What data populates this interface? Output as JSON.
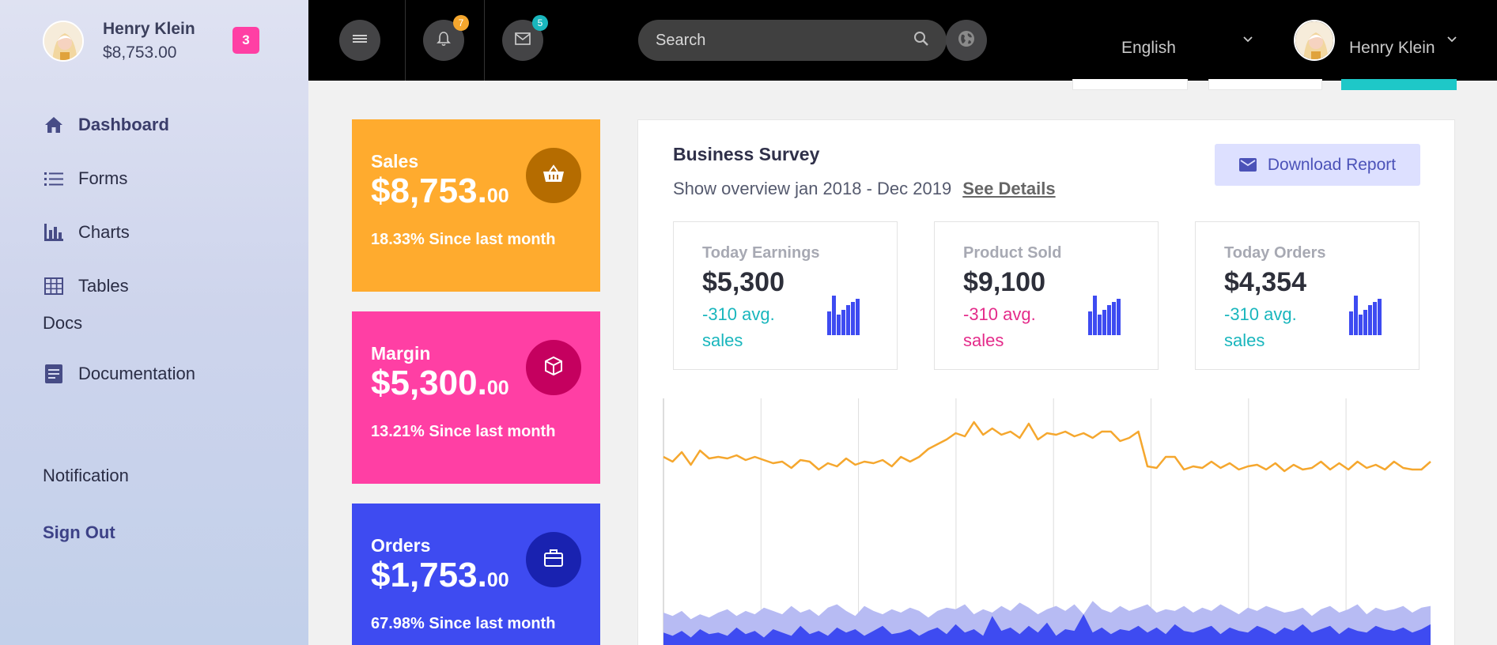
{
  "sidebar": {
    "user_name": "Henry Klein",
    "user_balance": "$8,753.00",
    "notification_badge": "3",
    "nav": [
      {
        "label": "Dashboard",
        "icon": "home-icon"
      },
      {
        "label": "Forms",
        "icon": "list-icon"
      },
      {
        "label": "Charts",
        "icon": "bar-chart-icon"
      },
      {
        "label": "Tables",
        "icon": "table-icon"
      }
    ],
    "docs_heading": "Docs",
    "documentation_label": "Documentation",
    "notification_label": "Notification",
    "signout_label": "Sign Out"
  },
  "topbar": {
    "bell_count": "7",
    "mail_count": "5",
    "search_placeholder": "Search",
    "language": "English",
    "user_name": "Henry Klein"
  },
  "cards": [
    {
      "title": "Sales",
      "value": "$8,753.",
      "cents": "00",
      "sub": "18.33% Since last month",
      "color": "#ffab2e",
      "icon_bg": "#b56c00",
      "icon": "basket-icon"
    },
    {
      "title": "Margin",
      "value": "$5,300.",
      "cents": "00",
      "sub": "13.21% Since last month",
      "color": "#ff3fa4",
      "icon_bg": "#c5005f",
      "icon": "cube-icon"
    },
    {
      "title": "Orders",
      "value": "$1,753.",
      "cents": "00",
      "sub": "67.98% Since last month",
      "color": "#3e4bf1",
      "icon_bg": "#1922b0",
      "icon": "briefcase-icon"
    }
  ],
  "survey": {
    "title": "Business Survey",
    "subtitle": "Show overview jan 2018 - Dec 2019",
    "see_details": "See Details",
    "download": "Download Report",
    "minis": [
      {
        "title": "Today Earnings",
        "value": "$5,300",
        "delta": "-310 avg. sales",
        "delta_color": "#19b6bd"
      },
      {
        "title": "Product Sold",
        "value": "$9,100",
        "delta": "-310 avg. sales",
        "delta_color": "#e42b8a"
      },
      {
        "title": "Today Orders",
        "value": "$4,354",
        "delta": "-310 avg. sales",
        "delta_color": "#19b6bd"
      }
    ]
  },
  "chart_data": {
    "type": "line",
    "title": "",
    "xlabel": "",
    "ylabel": "",
    "grid": "vertical",
    "series": [
      {
        "values": [
          58,
          55,
          61,
          53,
          62,
          57,
          58,
          57,
          59,
          56,
          58,
          56,
          54,
          55,
          51,
          56,
          55,
          50,
          54,
          52,
          57,
          53,
          55,
          54,
          56,
          52,
          58,
          55,
          58,
          63,
          66,
          69,
          73,
          71,
          80,
          72,
          76,
          72,
          74,
          70,
          79,
          69,
          73,
          72,
          74,
          71,
          73,
          70,
          74,
          74,
          68,
          70,
          74,
          52,
          51,
          58,
          58,
          50,
          52,
          51,
          55,
          51,
          54,
          50,
          52,
          53,
          50,
          54,
          49,
          53,
          50,
          51,
          55,
          50,
          54,
          50,
          55,
          51,
          53,
          50,
          55,
          51,
          50,
          50,
          55
        ],
        "color": "#f5a72e"
      },
      {
        "values": [
          20,
          18,
          21,
          16,
          19,
          17,
          20,
          22,
          18,
          21,
          19,
          23,
          21,
          19,
          24,
          20,
          22,
          18,
          23,
          25,
          21,
          18,
          24,
          21,
          19,
          22,
          20,
          23,
          21,
          17,
          21,
          23,
          22,
          25,
          19,
          22,
          20,
          24,
          21,
          26,
          23,
          19,
          22,
          24,
          21,
          25,
          19,
          27,
          22,
          20,
          24,
          21,
          23,
          25,
          20,
          22,
          21,
          24,
          20,
          23,
          21,
          25,
          22,
          19,
          23,
          21,
          24,
          22,
          20,
          21,
          23,
          18,
          22,
          24,
          20,
          22,
          25,
          19,
          23,
          21,
          22,
          24,
          20,
          23,
          24
        ],
        "color": "#b7bbf3"
      },
      {
        "values": [
          8,
          6,
          9,
          5,
          10,
          7,
          8,
          6,
          11,
          7,
          9,
          5,
          10,
          8,
          6,
          12,
          7,
          9,
          6,
          11,
          8,
          10,
          6,
          9,
          12,
          7,
          8,
          10,
          6,
          9,
          11,
          7,
          13,
          8,
          10,
          6,
          18,
          9,
          11,
          7,
          12,
          8,
          14,
          6,
          10,
          9,
          19,
          8,
          11,
          7,
          10,
          9,
          12,
          8,
          11,
          7,
          13,
          9,
          8,
          10,
          12,
          7,
          11,
          9,
          8,
          12,
          10,
          7,
          11,
          9,
          13,
          8,
          10,
          12,
          7,
          11,
          9,
          8,
          12,
          10,
          9,
          11,
          8,
          10,
          13
        ],
        "color": "#3e4bf1"
      }
    ]
  }
}
